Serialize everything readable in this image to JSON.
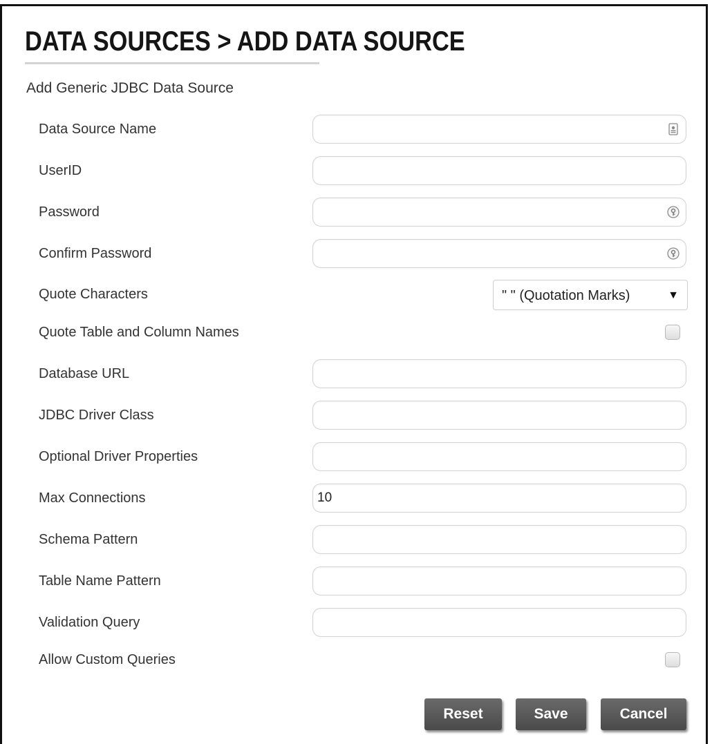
{
  "page": {
    "title": "DATA SOURCES > ADD DATA SOURCE",
    "subtitle": "Add Generic JDBC Data Source"
  },
  "fields": {
    "data_source_name": {
      "label": "Data Source Name",
      "value": "",
      "icon": "contact-card-icon"
    },
    "user_id": {
      "label": "UserID",
      "value": ""
    },
    "password": {
      "label": "Password",
      "value": "",
      "icon": "password-key-icon"
    },
    "confirm_password": {
      "label": "Confirm Password",
      "value": "",
      "icon": "password-key-icon"
    },
    "quote_characters": {
      "label": "Quote Characters",
      "value": "\" \" (Quotation Marks)"
    },
    "quote_names": {
      "label": "Quote Table and Column Names",
      "checked": false
    },
    "database_url": {
      "label": "Database URL",
      "value": ""
    },
    "jdbc_driver_class": {
      "label": "JDBC Driver Class",
      "value": ""
    },
    "optional_driver_properties": {
      "label": "Optional Driver Properties",
      "value": ""
    },
    "max_connections": {
      "label": "Max Connections",
      "value": "10"
    },
    "schema_pattern": {
      "label": "Schema Pattern",
      "value": ""
    },
    "table_name_pattern": {
      "label": "Table Name Pattern",
      "value": ""
    },
    "validation_query": {
      "label": "Validation Query",
      "value": ""
    },
    "allow_custom_queries": {
      "label": "Allow Custom Queries",
      "checked": false
    }
  },
  "buttons": {
    "reset": "Reset",
    "save": "Save",
    "cancel": "Cancel"
  },
  "colors": {
    "button_bg": "#555555",
    "button_text": "#ffffff",
    "title_text": "#151515",
    "label_text": "#333333"
  }
}
